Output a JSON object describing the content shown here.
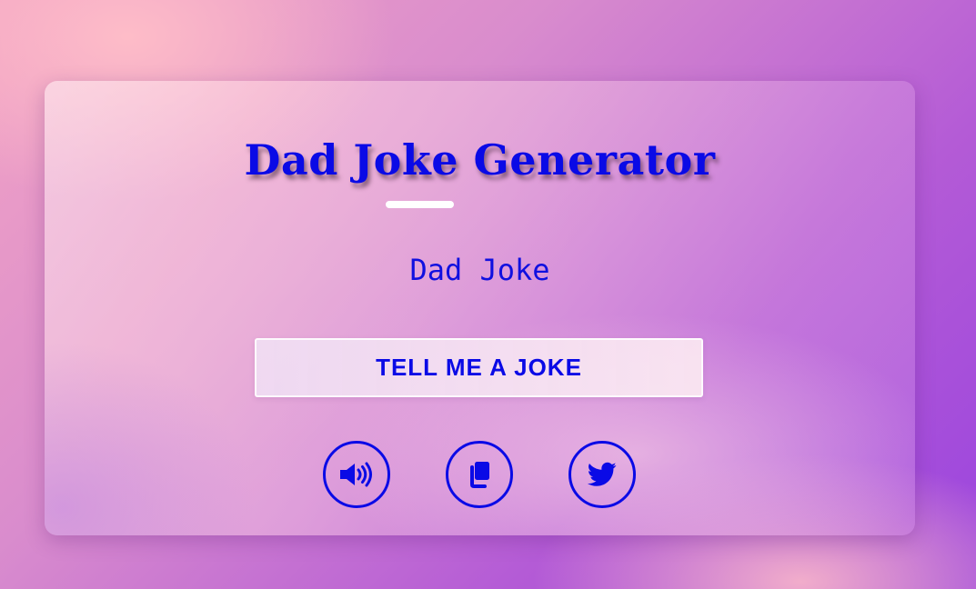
{
  "app": {
    "title": "Dad Joke Generator",
    "joke_text": "Dad Joke",
    "button_label": "TELL ME A JOKE"
  },
  "actions": [
    {
      "name": "speak",
      "icon": "speaker-icon"
    },
    {
      "name": "copy",
      "icon": "copy-icon"
    },
    {
      "name": "tweet",
      "icon": "twitter-icon"
    }
  ],
  "colors": {
    "accent": "#0a0ae6",
    "underline": "#ffffff",
    "background_start": "#f2a3c4",
    "background_end": "#9a44de"
  }
}
